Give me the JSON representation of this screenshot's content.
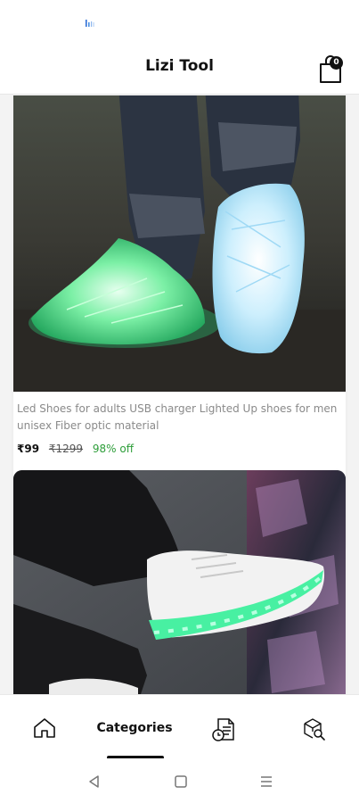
{
  "app": {
    "title": "Lizi Tool",
    "cart_count": "0"
  },
  "icons": {
    "status": "app-indicator-icon",
    "cart": "shopping-bag-icon",
    "home": "home-icon",
    "orders": "order-list-icon",
    "track": "box-search-icon",
    "back": "triangle-back-icon",
    "recents": "square-home-icon",
    "menu": "three-lines-menu-icon"
  },
  "products": [
    {
      "image": "glowing-led-fiber-optic-shoes-photo",
      "title": "Led Shoes for adults USB charger Lighted Up shoes for men unisex Fiber optic material",
      "price": "₹99",
      "mrp": "₹1299",
      "discount": "98% off"
    },
    {
      "image": "white-led-sole-sneaker-photo"
    }
  ],
  "bottom_nav": {
    "categories_label": "Categories",
    "active": "categories"
  },
  "colors": {
    "discount_green": "#2e9e3a",
    "background": "#f3f3f3"
  }
}
